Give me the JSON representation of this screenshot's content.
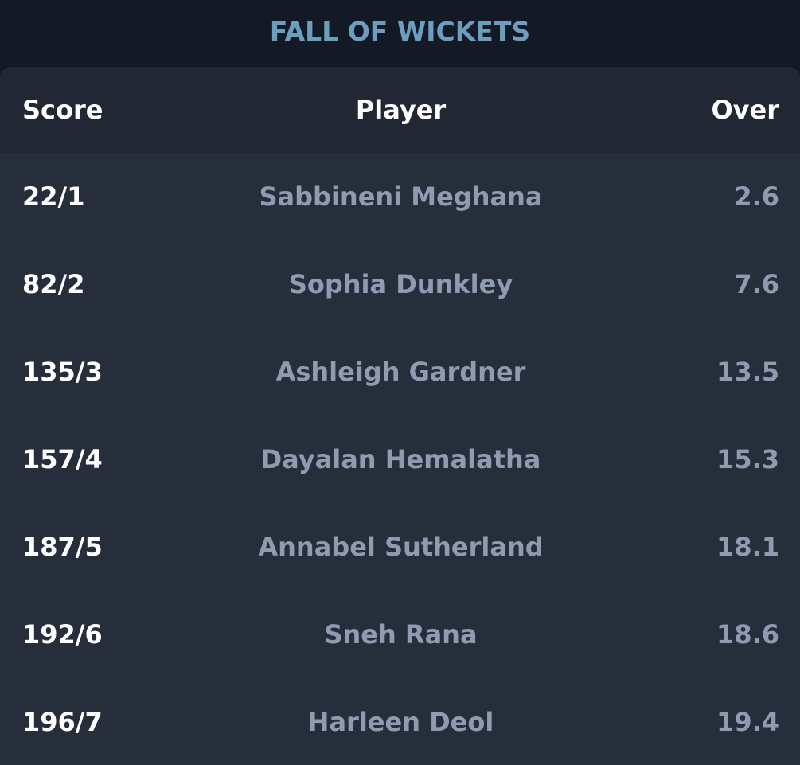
{
  "header": {
    "title": "FALL OF WICKETS"
  },
  "table": {
    "columns": {
      "score": "Score",
      "player": "Player",
      "over": "Over"
    },
    "rows": [
      {
        "score": "22/1",
        "player": "Sabbineni Meghana",
        "over": "2.6"
      },
      {
        "score": "82/2",
        "player": "Sophia Dunkley",
        "over": "7.6"
      },
      {
        "score": "135/3",
        "player": "Ashleigh Gardner",
        "over": "13.5"
      },
      {
        "score": "157/4",
        "player": "Dayalan Hemalatha",
        "over": "15.3"
      },
      {
        "score": "187/5",
        "player": "Annabel Sutherland",
        "over": "18.1"
      },
      {
        "score": "192/6",
        "player": "Sneh Rana",
        "over": "18.6"
      },
      {
        "score": "196/7",
        "player": "Harleen Deol",
        "over": "19.4"
      }
    ]
  },
  "colors": {
    "background": "#141a25",
    "panel": "#272e3b",
    "header_row": "#212834",
    "title": "#6d9ebd",
    "primary_text": "#ffffff",
    "secondary_text": "#8e9bb1"
  }
}
